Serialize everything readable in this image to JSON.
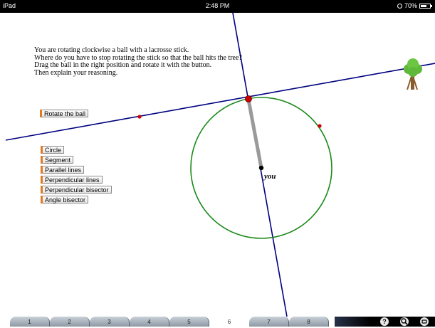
{
  "statusbar": {
    "device": "iPad",
    "time": "2:48 PM",
    "battery": "70%",
    "battery_level": 0.7
  },
  "instructions": [
    "You are rotating clockwise a ball with a lacrosse stick.",
    "Where do you have to stop rotating the stick so that the ball hits the tree?",
    "Drag the ball in the right position and rotate it with the button.",
    "Then explain your reasoning."
  ],
  "buttons": {
    "rotate": "Rotate the ball"
  },
  "tools": [
    "Circle",
    "Segment",
    "Parallel lines",
    "Perpendicular lines",
    "Perpendicular bisector",
    "Angle bisector"
  ],
  "canvas": {
    "center_label": "you"
  },
  "colors": {
    "line": "#000080",
    "circle": "#1a8a1a",
    "stick": "#9a9a9a",
    "point_red": "#cc0000",
    "button_accent": "#e07b24"
  },
  "tabs": [
    {
      "label": "1",
      "active": false
    },
    {
      "label": "2",
      "active": false
    },
    {
      "label": "3",
      "active": false
    },
    {
      "label": "4",
      "active": false
    },
    {
      "label": "5",
      "active": false
    },
    {
      "label": "6",
      "active": true
    },
    {
      "label": "7",
      "active": false
    },
    {
      "label": "8",
      "active": false
    }
  ],
  "toolbar_icons": [
    "help-icon",
    "zoom-icon",
    "menu-icon"
  ],
  "toolbar_help_glyph": "?"
}
